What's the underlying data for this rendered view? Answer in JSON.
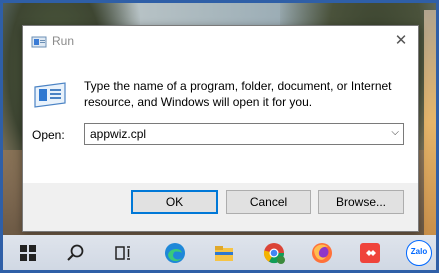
{
  "dialog": {
    "title": "Run",
    "description": "Type the name of a program, folder, document, or Internet resource, and Windows will open it for you.",
    "open_label": "Open:",
    "open_value": "appwiz.cpl",
    "ok_label": "OK",
    "cancel_label": "Cancel",
    "browse_label": "Browse..."
  },
  "icons": {
    "title": "run-icon",
    "close": "close-icon",
    "content": "run-app-icon",
    "dropdown": "chevron-down-icon"
  },
  "taskbar": {
    "items": [
      {
        "name": "start-icon"
      },
      {
        "name": "search-icon"
      },
      {
        "name": "task-view-icon"
      },
      {
        "name": "edge-icon"
      },
      {
        "name": "file-explorer-icon"
      },
      {
        "name": "chrome-icon"
      },
      {
        "name": "firefox-icon"
      },
      {
        "name": "anydesk-icon"
      },
      {
        "name": "zalo-icon",
        "label": "Zalo"
      }
    ]
  },
  "colors": {
    "accent": "#0078d7",
    "frame": "#2f5fa7",
    "dialog_bg": "#f0f0f0"
  }
}
